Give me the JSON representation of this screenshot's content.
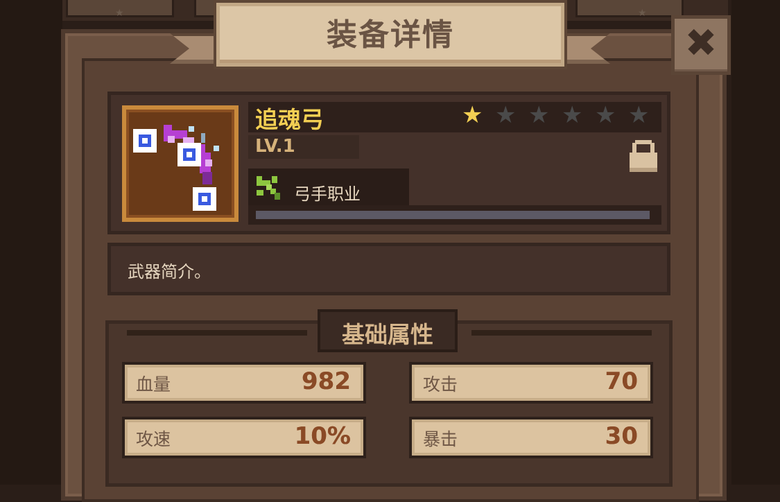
{
  "title": "装备详情",
  "close_icon": "close-x-icon",
  "equipment": {
    "name": "追魂弓",
    "level": "LV.1",
    "stars_filled": 1,
    "stars_total": 6,
    "star_colors": {
      "filled": "#f3cf53",
      "empty": "#4a4a4a"
    },
    "class_icon": "bow-class-icon",
    "class_label": "弓手职业",
    "xp_fraction": 1.0,
    "locked": true,
    "item_icon": "purple-bow-icon"
  },
  "description": "武器简介。",
  "attributes": {
    "header": "基础属性",
    "stats": [
      {
        "label": "血量",
        "value": "982"
      },
      {
        "label": "攻击",
        "value": "70"
      },
      {
        "label": "攻速",
        "value": "10%"
      },
      {
        "label": "暴击",
        "value": "30"
      }
    ]
  }
}
